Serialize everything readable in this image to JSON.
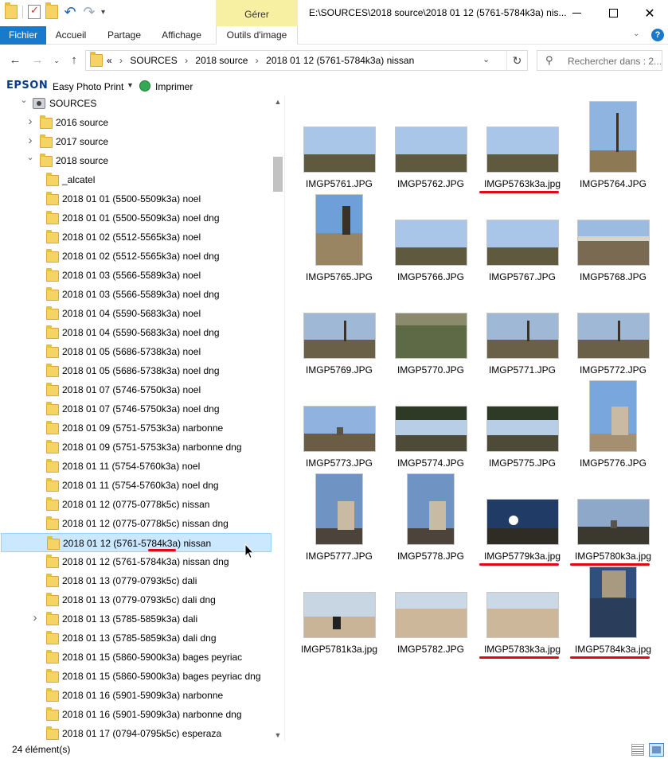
{
  "window": {
    "title": "E:\\SOURCES\\2018 source\\2018 01 12 (5761-5784k3a) nis...",
    "manage_tab": "Gérer"
  },
  "ribbon": {
    "tabs": [
      {
        "label": "Fichier"
      },
      {
        "label": "Accueil"
      },
      {
        "label": "Partage"
      },
      {
        "label": "Affichage"
      },
      {
        "label": "Outils d'image"
      }
    ]
  },
  "address": {
    "overflow": "«",
    "crumbs": [
      "SOURCES",
      "2018 source",
      "2018 01 12 (5761-5784k3a) nissan"
    ]
  },
  "search": {
    "placeholder": "Rechercher dans : 2..."
  },
  "epson": {
    "logo": "EPSON",
    "app": "Easy Photo Print",
    "print": "Imprimer"
  },
  "tree": [
    {
      "label": "SOURCES",
      "level": 1,
      "arrow": "open",
      "icon": "drive"
    },
    {
      "label": "2016 source",
      "level": 2,
      "arrow": "closed"
    },
    {
      "label": "2017 source",
      "level": 2,
      "arrow": "closed"
    },
    {
      "label": "2018 source",
      "level": 2,
      "arrow": "open"
    },
    {
      "label": "_alcatel",
      "level": 3
    },
    {
      "label": "2018 01 01 (5500-5509k3a) noel",
      "level": 3
    },
    {
      "label": "2018 01 01 (5500-5509k3a) noel dng",
      "level": 3
    },
    {
      "label": "2018 01 02 (5512-5565k3a) noel",
      "level": 3
    },
    {
      "label": "2018 01 02 (5512-5565k3a) noel dng",
      "level": 3
    },
    {
      "label": "2018 01 03 (5566-5589k3a) noel",
      "level": 3
    },
    {
      "label": "2018 01 03 (5566-5589k3a) noel dng",
      "level": 3
    },
    {
      "label": "2018 01 04 (5590-5683k3a) noel",
      "level": 3
    },
    {
      "label": "2018 01 04 (5590-5683k3a) noel dng",
      "level": 3
    },
    {
      "label": "2018 01 05 (5686-5738k3a) noel",
      "level": 3
    },
    {
      "label": "2018 01 05 (5686-5738k3a) noel dng",
      "level": 3
    },
    {
      "label": "2018 01 07 (5746-5750k3a) noel",
      "level": 3
    },
    {
      "label": "2018 01 07 (5746-5750k3a) noel dng",
      "level": 3
    },
    {
      "label": "2018 01 09 (5751-5753k3a) narbonne",
      "level": 3
    },
    {
      "label": "2018 01 09 (5751-5753k3a) narbonne dng",
      "level": 3
    },
    {
      "label": "2018 01 11 (5754-5760k3a) noel",
      "level": 3
    },
    {
      "label": "2018 01 11 (5754-5760k3a) noel dng",
      "level": 3
    },
    {
      "label": "2018 01 12 (0775-0778k5c) nissan",
      "level": 3
    },
    {
      "label": "2018 01 12 (0775-0778k5c) nissan dng",
      "level": 3
    },
    {
      "label": "2018 01 12 (5761-5784k3a) nissan",
      "level": 3,
      "selected": true
    },
    {
      "label": "2018 01 12 (5761-5784k3a) nissan dng",
      "level": 3
    },
    {
      "label": "2018 01 13 (0779-0793k5c) dali",
      "level": 3
    },
    {
      "label": "2018 01 13 (0779-0793k5c) dali dng",
      "level": 3
    },
    {
      "label": "2018 01 13 (5785-5859k3a) dali",
      "level": 3,
      "arrow": "closed"
    },
    {
      "label": "2018 01 13 (5785-5859k3a) dali dng",
      "level": 3
    },
    {
      "label": "2018 01 15 (5860-5900k3a) bages peyriac",
      "level": 3
    },
    {
      "label": "2018 01 15 (5860-5900k3a) bages peyriac dng",
      "level": 3
    },
    {
      "label": "2018 01 16 (5901-5909k3a) narbonne",
      "level": 3
    },
    {
      "label": "2018 01 16 (5901-5909k3a) narbonne dng",
      "level": 3
    },
    {
      "label": "2018 01 17 (0794-0795k5c) esperaza",
      "level": 3
    }
  ],
  "files": [
    {
      "name": "IMGP5761.JPG",
      "orient": "land",
      "scene": "hills"
    },
    {
      "name": "IMGP5762.JPG",
      "orient": "land",
      "scene": "hills"
    },
    {
      "name": "IMGP5763k3a.jpg",
      "orient": "land",
      "scene": "hills",
      "marked": true
    },
    {
      "name": "IMGP5764.JPG",
      "orient": "port",
      "scene": "tree"
    },
    {
      "name": "IMGP5765.JPG",
      "orient": "port",
      "scene": "trunk"
    },
    {
      "name": "IMGP5766.JPG",
      "orient": "land",
      "scene": "hills"
    },
    {
      "name": "IMGP5767.JPG",
      "orient": "land",
      "scene": "hills"
    },
    {
      "name": "IMGP5768.JPG",
      "orient": "land",
      "scene": "town"
    },
    {
      "name": "IMGP5769.JPG",
      "orient": "land",
      "scene": "trees"
    },
    {
      "name": "IMGP5770.JPG",
      "orient": "land",
      "scene": "scrub"
    },
    {
      "name": "IMGP5771.JPG",
      "orient": "land",
      "scene": "trees"
    },
    {
      "name": "IMGP5772.JPG",
      "orient": "land",
      "scene": "trees"
    },
    {
      "name": "IMGP5773.JPG",
      "orient": "land",
      "scene": "mill"
    },
    {
      "name": "IMGP5774.JPG",
      "orient": "land",
      "scene": "pines"
    },
    {
      "name": "IMGP5775.JPG",
      "orient": "land",
      "scene": "pines"
    },
    {
      "name": "IMGP5776.JPG",
      "orient": "port",
      "scene": "windmill"
    },
    {
      "name": "IMGP5777.JPG",
      "orient": "port",
      "scene": "windmill-dark"
    },
    {
      "name": "IMGP5778.JPG",
      "orient": "port",
      "scene": "windmill-dark"
    },
    {
      "name": "IMGP5779k3a.jpg",
      "orient": "land",
      "scene": "sun",
      "marked": true
    },
    {
      "name": "IMGP5780k3a.jpg",
      "orient": "land",
      "scene": "mill-dark",
      "marked": true
    },
    {
      "name": "IMGP5781k3a.jpg",
      "orient": "land",
      "scene": "beach-people"
    },
    {
      "name": "IMGP5782.JPG",
      "orient": "land",
      "scene": "beach"
    },
    {
      "name": "IMGP5783k3a.jpg",
      "orient": "land",
      "scene": "beach",
      "marked": true
    },
    {
      "name": "IMGP5784k3a.jpg",
      "orient": "port",
      "scene": "reflection",
      "marked": true
    }
  ],
  "status": {
    "count": "24 élément(s)"
  },
  "colors": {
    "accent": "#1979ca",
    "selection": "#cce8ff",
    "annotation_red": "#e30613",
    "manage_tab": "#f7f0a3"
  }
}
